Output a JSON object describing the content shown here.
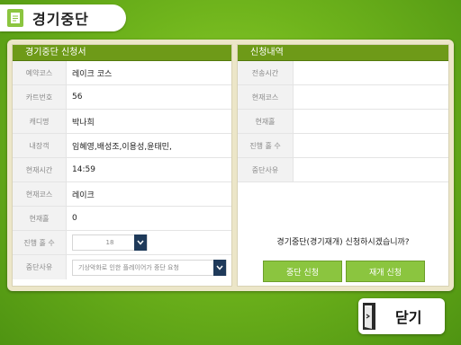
{
  "title": "경기중단",
  "left_panel": {
    "header": "경기중단 신청서",
    "rows": [
      {
        "label": "예약코스",
        "value": "레이크 코스"
      },
      {
        "label": "카트번호",
        "value": "56"
      },
      {
        "label": "캐디명",
        "value": "박나희"
      },
      {
        "label": "내장객",
        "value": "임혜영,배성조,이용성,윤태민,"
      },
      {
        "label": "현재시간",
        "value": "14:59"
      },
      {
        "label": "현재코스",
        "value": "레이크"
      },
      {
        "label": "현재홀",
        "value": "0"
      }
    ],
    "progress_holes": {
      "label": "진행 홀 수",
      "value": "18"
    },
    "reason": {
      "label": "중단사유",
      "value": "기상악화로 인한 플레이어가 중단 요청"
    }
  },
  "right_panel": {
    "header": "신청내역",
    "rows": [
      {
        "label": "전송시간",
        "value": ""
      },
      {
        "label": "현재코스",
        "value": ""
      },
      {
        "label": "현재홀",
        "value": ""
      },
      {
        "label": "진행 홀 수",
        "value": ""
      },
      {
        "label": "중단사유",
        "value": ""
      }
    ],
    "confirm_text": "경기중단(경기재개) 신청하시겠습니까?",
    "stop_button": "중단 신청",
    "resume_button": "재개 신청"
  },
  "close_button": "닫기",
  "icons": {
    "title": "document-icon",
    "close": "exit-door-icon",
    "dropdown": "chevron-down-icon"
  },
  "colors": {
    "accent_green": "#8bc53f",
    "header_green": "#6e9a18",
    "dropdown_navy": "#1f3a5a"
  }
}
